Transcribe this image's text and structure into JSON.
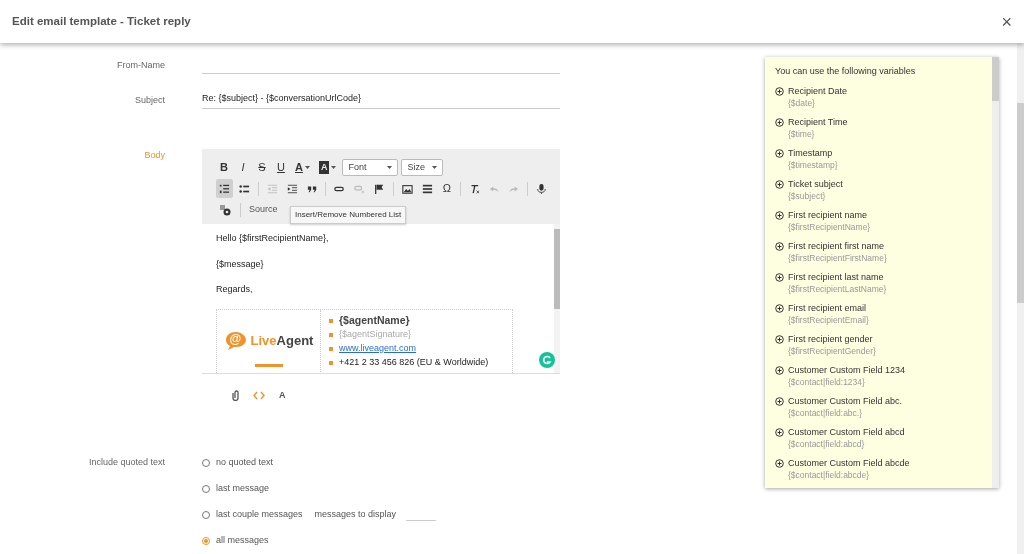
{
  "dialog": {
    "title": "Edit email template - Ticket reply",
    "close": "×"
  },
  "fields": [
    {
      "label": "From-Name",
      "kind": "text",
      "active": false
    },
    {
      "label": "Subject",
      "value": "Re: {$subject} - {$conversationUrlCode}",
      "kind": "text",
      "active": false
    },
    {
      "label": "Body",
      "kind": "editor",
      "active": true
    }
  ],
  "toolbar": {
    "rows": [
      [
        {
          "kind": "char",
          "label": "B",
          "selected": false,
          "disabled": false
        },
        {
          "kind": "char",
          "label": "I",
          "selected": false,
          "disabled": false
        },
        {
          "kind": "char",
          "label": "S",
          "selected": false,
          "disabled": false
        },
        {
          "kind": "char",
          "label": "U",
          "selected": false,
          "disabled": false
        },
        {
          "kind": "color",
          "label": "A",
          "selected": false,
          "disabled": false
        },
        {
          "kind": "color",
          "label": "A",
          "selected": false,
          "disabled": false
        },
        {
          "kind": "select",
          "label": "Font"
        },
        {
          "kind": "select",
          "label": "Size"
        }
      ],
      [
        {
          "kind": "icon",
          "selected": true,
          "disabled": false
        },
        {
          "kind": "icon",
          "selected": false,
          "disabled": false
        },
        {
          "kind": "sep"
        },
        {
          "kind": "icon",
          "selected": false,
          "disabled": true
        },
        {
          "kind": "icon",
          "selected": false,
          "disabled": false
        },
        {
          "kind": "icon",
          "selected": false,
          "disabled": false
        },
        {
          "kind": "sep"
        },
        {
          "kind": "icon",
          "selected": false,
          "disabled": false
        },
        {
          "kind": "icon",
          "selected": false,
          "disabled": true
        },
        {
          "kind": "icon",
          "selected": false,
          "disabled": false
        },
        {
          "kind": "sep"
        },
        {
          "kind": "icon",
          "selected": false,
          "disabled": false
        },
        {
          "kind": "icon",
          "selected": false,
          "disabled": false
        },
        {
          "kind": "char",
          "label": "Ω",
          "selected": false,
          "disabled": false
        },
        {
          "kind": "sep"
        },
        {
          "kind": "icon",
          "selected": false,
          "disabled": false
        },
        {
          "kind": "icon",
          "selected": false,
          "disabled": true
        },
        {
          "kind": "icon",
          "selected": false,
          "disabled": true
        },
        {
          "kind": "sep"
        },
        {
          "kind": "icon",
          "selected": false,
          "disabled": false
        }
      ],
      [
        {
          "kind": "icon",
          "selected": false,
          "disabled": false
        },
        {
          "kind": "sep"
        },
        {
          "kind": "source",
          "label": "Source"
        }
      ]
    ],
    "tooltip": "Insert/Remove Numbered List"
  },
  "body": {
    "lines": [
      "Hello {$firstRecipientName},",
      "{$message}",
      "Regards,"
    ],
    "logo": {
      "symbol": "@",
      "part1": "Live",
      "part2": "Agent"
    },
    "signature": [
      {
        "kind": "bold",
        "text": "{$agentName}"
      },
      {
        "kind": "muted",
        "text": "{$agentSignature}"
      },
      {
        "kind": "link",
        "text": "www.liveagent.com"
      },
      {
        "kind": "plain",
        "text": "+421 2 33 456 826 (EU & Worldwide)"
      }
    ]
  },
  "editor_footer": [
    {
      "kind": "attach",
      "selected": false
    },
    {
      "kind": "code",
      "selected": true
    },
    {
      "kind": "format",
      "label": "A",
      "selected": false
    }
  ],
  "quoted": {
    "label": "Include quoted text",
    "options": [
      {
        "label": "no quoted text",
        "selected": false
      },
      {
        "label": "last message",
        "selected": false
      },
      {
        "label": "last couple messages",
        "selected": false,
        "extra": "messages to display"
      },
      {
        "label": "all messages",
        "selected": true
      }
    ]
  },
  "variables": {
    "title": "You can use the following variables",
    "items": [
      {
        "name": "Recipient Date",
        "code": "{$date}"
      },
      {
        "name": "Recipient Time",
        "code": "{$time}"
      },
      {
        "name": "Timestamp",
        "code": "{$timestamp}"
      },
      {
        "name": "Ticket subject",
        "code": "{$subject}"
      },
      {
        "name": "First recipient name",
        "code": "{$firstRecipientName}"
      },
      {
        "name": "First recipient first name",
        "code": "{$firstRecipientFirstName}"
      },
      {
        "name": "First recipient last name",
        "code": "{$firstRecipientLastName}"
      },
      {
        "name": "First recipient email",
        "code": "{$firstRecipientEmail}"
      },
      {
        "name": "First recipient gender",
        "code": "{$firstRecipientGender}"
      },
      {
        "name": "Customer Custom Field 1234",
        "code": "{$contact|field:1234}"
      },
      {
        "name": "Customer Custom Field abc.",
        "code": "{$contact|field:abc.}"
      },
      {
        "name": "Customer Custom Field abcd",
        "code": "{$contact|field:abcd}"
      },
      {
        "name": "Customer Custom Field abcde",
        "code": "{$contact|field:abcde}"
      }
    ]
  }
}
